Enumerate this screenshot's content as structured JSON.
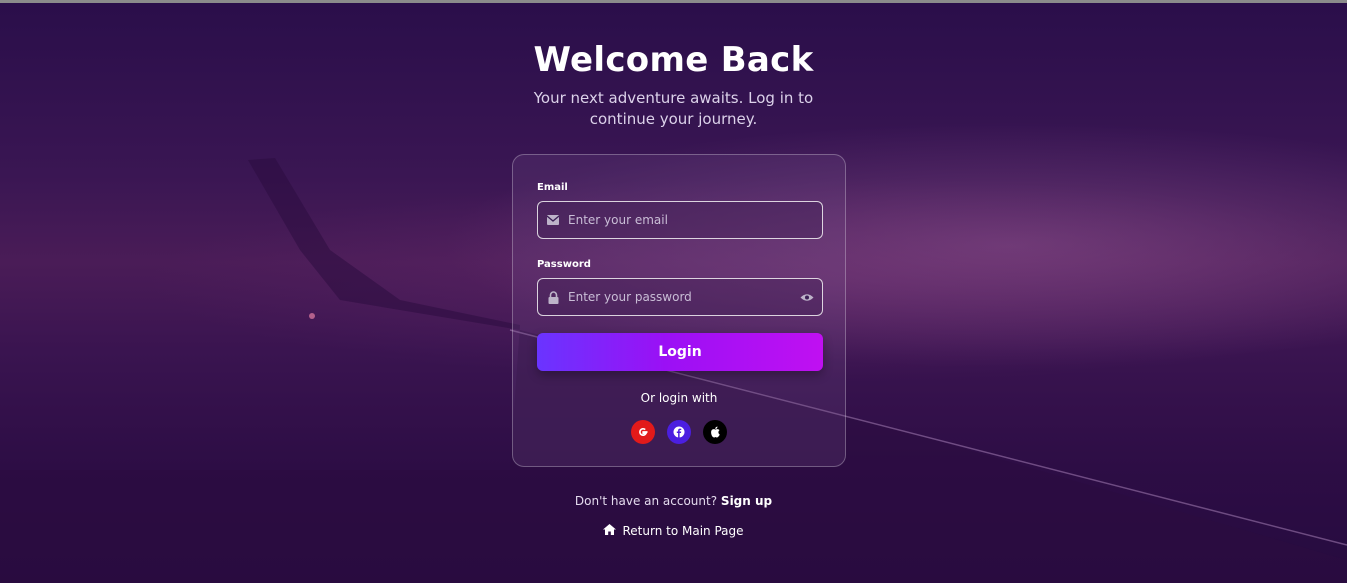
{
  "header": {
    "title": "Welcome Back",
    "subtitle": "Your next adventure awaits. Log in to continue your journey."
  },
  "form": {
    "email_label": "Email",
    "email_placeholder": "Enter your email",
    "password_label": "Password",
    "password_placeholder": "Enter your password",
    "login_label": "Login",
    "or_text": "Or login with"
  },
  "social": [
    {
      "name": "google-icon",
      "color": "#e21a1a"
    },
    {
      "name": "facebook-icon",
      "color": "#4b1fe0"
    },
    {
      "name": "apple-icon",
      "color": "#000000"
    }
  ],
  "footer": {
    "signup_prompt": "Don't have an account?",
    "signup_link": "Sign up",
    "return_label": "Return to Main Page"
  },
  "colors": {
    "accent_start": "#6a34ff",
    "accent_end": "#c010f2",
    "background": "#2a0f45"
  }
}
